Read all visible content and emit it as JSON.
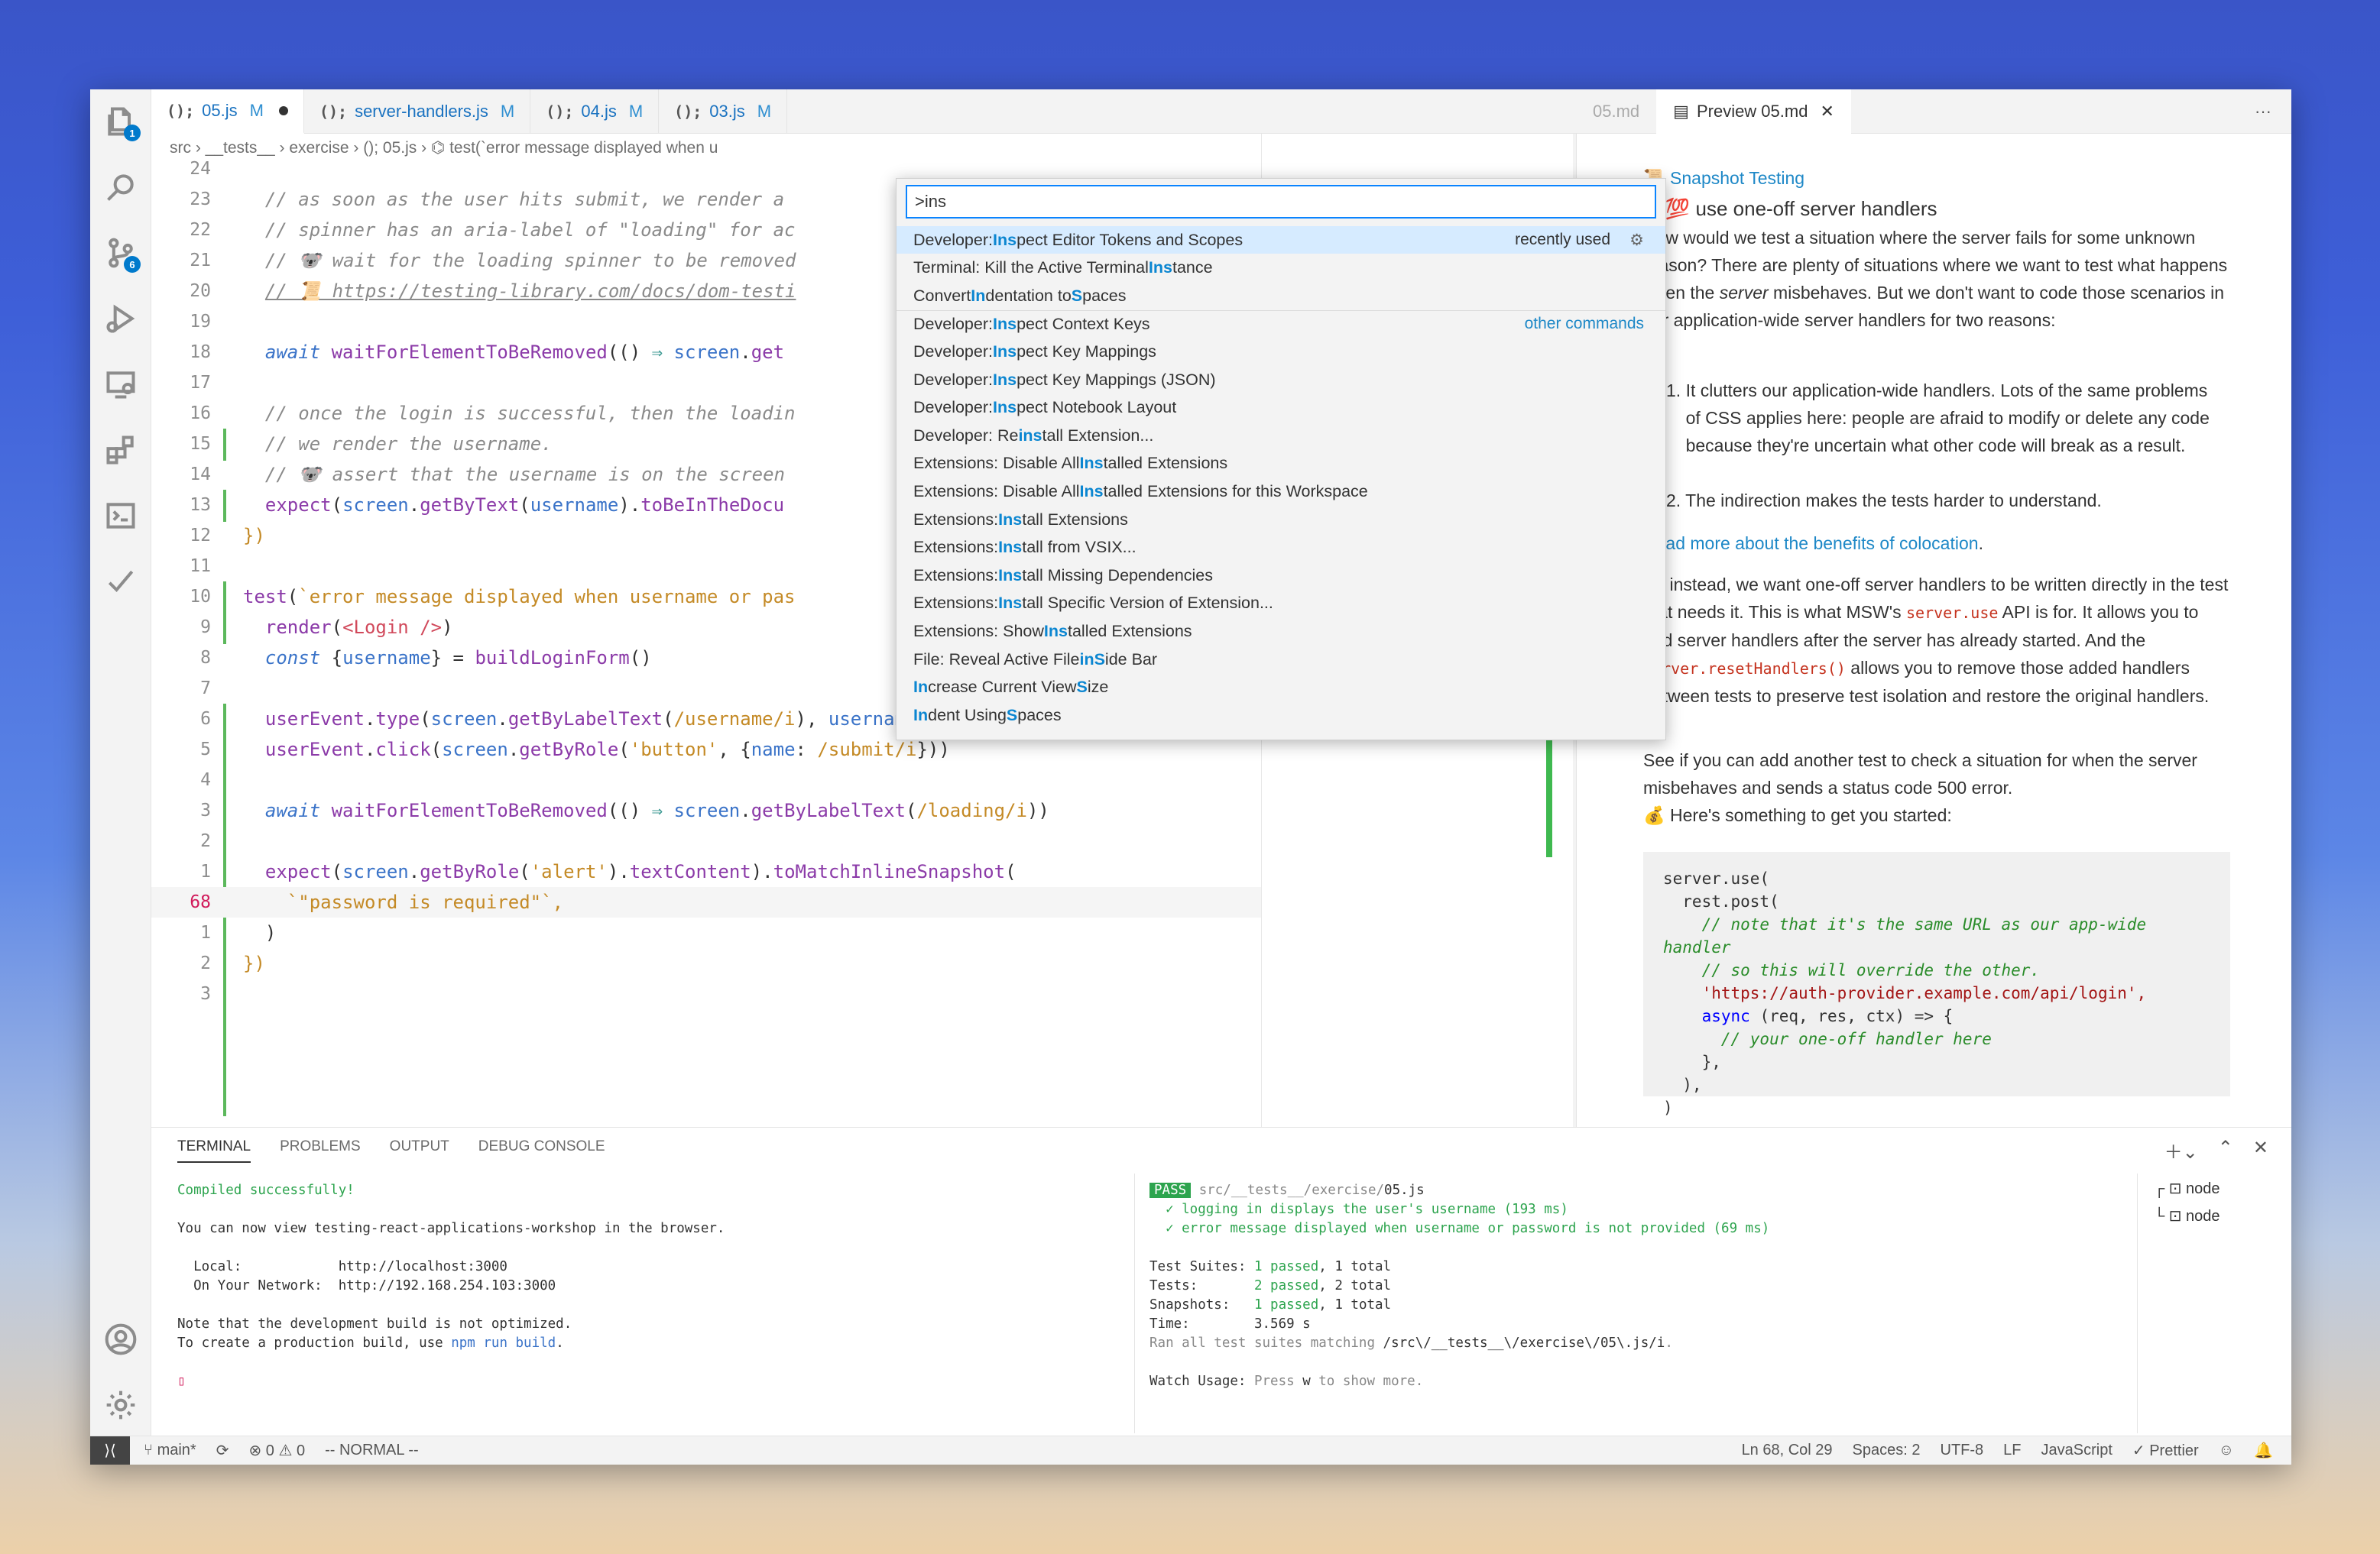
{
  "tabs": [
    {
      "icon": "();",
      "name": "05.js",
      "mod": "M",
      "dirty": true
    },
    {
      "icon": "();",
      "name": "server-handlers.js",
      "mod": "M"
    },
    {
      "icon": "();",
      "name": "04.js",
      "mod": "M"
    },
    {
      "icon": "();",
      "name": "03.js",
      "mod": "M"
    }
  ],
  "preview_tabs": {
    "hidden": "05.md",
    "active": "Preview 05.md",
    "more": "···"
  },
  "breadcrumb": "src  ›  __tests__  ›  exercise  ›  (); 05.js  ›  ⌬ test(`error message displayed when u",
  "badges": {
    "explorer": "1",
    "scm": "6"
  },
  "code": {
    "l24": "24",
    "l23": "23",
    "c23": "// as soon as the user hits submit, we render a",
    "l22": "22",
    "c22": "// spinner has an aria-label of \"loading\" for ac",
    "l21": "21",
    "c21": "// 🐨 wait for the loading spinner to be removed",
    "l20": "20",
    "c20": "// 📜 https://testing-library.com/docs/dom-testi",
    "l19": "19",
    "l18": "18",
    "l17": "17",
    "l16": "16",
    "c16": "// once the login is successful, then the loadin",
    "l15": "15",
    "c15": "// we render the username.",
    "l14": "14",
    "c14": "// 🐨 assert that the username is on the screen",
    "l13": "13",
    "l12": "12",
    "l11": "11",
    "l10": "10",
    "l9": "9",
    "l8": "8",
    "l7": "7",
    "l6": "6",
    "l5": "5",
    "l4": "4",
    "l3": "3",
    "l2": "2",
    "l1": "1",
    "l68": "68",
    "l1b": "1",
    "l2b": "2",
    "l3b": "3",
    "s10a": "`error message displayed when username or pas",
    "s5": "'button'",
    "s5b": "/submit/i",
    "s3": "/loading/i",
    "s1": "'alert'",
    "s68": "`\"password is required\"`,"
  },
  "palette": {
    "input": ">ins",
    "items": [
      {
        "pre": "Developer: ",
        "hl": "Ins",
        "post": "pect Editor Tokens and Scopes",
        "right": "recently used"
      },
      {
        "pre": "Terminal: Kill the Active Terminal ",
        "hl": "Ins",
        "post": "tance",
        "right": ""
      },
      {
        "pre": "Convert ",
        "hl": "In",
        "post": "dentation to ",
        "hl2": "S",
        "post2": "paces",
        "right": ""
      },
      {
        "pre": "Developer: ",
        "hl": "Ins",
        "post": "pect Context Keys",
        "right": "other commands"
      },
      {
        "pre": "Developer: ",
        "hl": "Ins",
        "post": "pect Key Mappings",
        "right": ""
      },
      {
        "pre": "Developer: ",
        "hl": "Ins",
        "post": "pect Key Mappings (JSON)",
        "right": ""
      },
      {
        "pre": "Developer: ",
        "hl": "Ins",
        "post": "pect Notebook Layout",
        "right": ""
      },
      {
        "pre": "Developer: Re",
        "hl": "ins",
        "post": "tall Extension...",
        "right": ""
      },
      {
        "pre": "Extensions: Disable All ",
        "hl": "Ins",
        "post": "talled Extensions",
        "right": ""
      },
      {
        "pre": "Extensions: Disable All ",
        "hl": "Ins",
        "post": "talled Extensions for this Workspace",
        "right": ""
      },
      {
        "pre": "Extensions: ",
        "hl": "Ins",
        "post": "tall Extensions",
        "right": ""
      },
      {
        "pre": "Extensions: ",
        "hl": "Ins",
        "post": "tall from VSIX...",
        "right": ""
      },
      {
        "pre": "Extensions: ",
        "hl": "Ins",
        "post": "tall Missing Dependencies",
        "right": ""
      },
      {
        "pre": "Extensions: ",
        "hl": "Ins",
        "post": "tall Specific Version of Extension...",
        "right": ""
      },
      {
        "pre": "Extensions: Show ",
        "hl": "Ins",
        "post": "talled Extensions",
        "right": ""
      },
      {
        "pre": "File: Reveal Active File ",
        "hl": "in",
        "post": " ",
        "hl2": "S",
        "post2": "ide Bar",
        "right": ""
      },
      {
        "pre": "",
        "hl": "In",
        "post": "crease Current View ",
        "hl2": "S",
        "post2": "ize",
        "right": ""
      },
      {
        "pre": "",
        "hl": "In",
        "post": "dent Using ",
        "hl2": "S",
        "post2": "paces",
        "right": ""
      }
    ]
  },
  "preview": {
    "snap": "Snapshot Testing",
    "h4": "4. 💯 use one-off server handlers",
    "p1": "How would we test a situation where the server fails for some unknown reason? There are plenty of situations where we want to test what happens when the",
    "p1em": "server",
    "p1b": "misbehaves. But we don't want to code those scenarios in our application-wide server handlers for two reasons:",
    "li1": "It clutters our application-wide handlers. Lots of the same problems of CSS applies here: people are afraid to modify or delete any code because they're uncertain what other code will break as a result.",
    "li2": "The indirection makes the tests harder to understand.",
    "readmore": "Read more about the benefits of colocation",
    "p2a": "So instead, we want one-off server handlers to be written directly in the test that needs it. This is what MSW's",
    "p2code": "server.use",
    "p2b": "API is for. It allows you to add server handlers after the server has already started. And the",
    "p2code2": "server.resetHandlers()",
    "p2c": "allows you to remove those added handlers between tests to preserve test isolation and restore the original handlers.",
    "p3": "See if you can add another test to check a situation for when the server misbehaves and sends a status code 500 error.",
    "p4": "💰 Here's something to get you started:",
    "cb1": "server.use(",
    "cb2": "  rest.post(",
    "cb3": "    // note that it's the same URL as our app-wide",
    "cb4": "handler",
    "cb5": "    // so this will override the other.",
    "cb6": "    'https://auth-provider.example.com/api/login',",
    "cb7a": "    async",
    "cb7b": " (req, res, ctx) => {",
    "cb8": "      // your one-off handler here",
    "cb9": "    },",
    "cb10": "  ),",
    "cb11": ")"
  },
  "terminal": {
    "tabs": [
      "TERMINAL",
      "PROBLEMS",
      "OUTPUT",
      "DEBUG CONSOLE"
    ],
    "left": {
      "l1": "Compiled successfully!",
      "l2": "You can now view testing-react-applications-workshop in the browser.",
      "l3": "  Local:            http://localhost:3000",
      "l4": "  On Your Network:  http://192.168.254.103:3000",
      "l5": "Note that the development build is not optimized.",
      "l6a": "To create a production build, use ",
      "l6b": "npm run build",
      "l6c": "."
    },
    "right": {
      "pass": "PASS",
      "file": " src/__tests__/exercise/",
      "file2": "05.js",
      "t1": "  ✓ logging in displays the user's username (193 ms)",
      "t2": "  ✓ error message displayed when username or password is not provided (69 ms)",
      "s1a": "Test Suites: ",
      "s1b": "1 passed",
      "s1c": ", 1 total",
      "s2a": "Tests:       ",
      "s2b": "2 passed",
      "s2c": ", 2 total",
      "s3a": "Snapshots:   ",
      "s3b": "1 passed",
      "s3c": ", 1 total",
      "s4": "Time:        3.569 s",
      "s5a": "Ran all test suites matching ",
      "s5b": "/src\\/__tests__\\/exercise\\/05\\.js/i",
      "s5c": ".",
      "w1a": "Watch Usage: ",
      "w1b": "Press ",
      "w1c": "w",
      "w1d": " to show more."
    },
    "shells": [
      "node",
      "node"
    ]
  },
  "status": {
    "branch": "main*",
    "problems": "⊗ 0 ⚠ 0",
    "mode": "-- NORMAL --",
    "pos": "Ln 68, Col 29",
    "spaces": "Spaces: 2",
    "enc": "UTF-8",
    "eol": "LF",
    "lang": "JavaScript",
    "prettier": "✓ Prettier"
  }
}
